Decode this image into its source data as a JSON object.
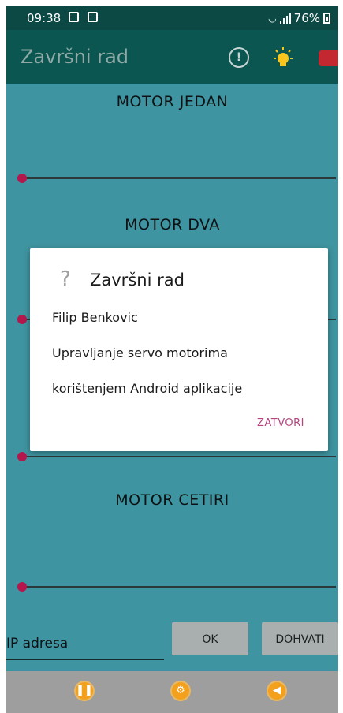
{
  "status_bar": {
    "time": "09:38",
    "battery": "76%"
  },
  "toolbar": {
    "title": "Završni rad",
    "icons": [
      "info-icon",
      "light-bulb-icon",
      "exit-icon"
    ]
  },
  "motors": {
    "motor1": {
      "label": "MOTOR JEDAN",
      "value": 0
    },
    "motor2": {
      "label": "MOTOR DVA",
      "value": 0
    },
    "motor3": {
      "value": 0
    },
    "motor4": {
      "label": "MOTOR CETIRI",
      "value": 0
    }
  },
  "controls": {
    "ip_placeholder": "IP adresa",
    "ok_label": "OK",
    "fetch_label": "DOHVATI"
  },
  "bottom_nav": {
    "icons": [
      "pause-icon",
      "gear-icon",
      "back-icon"
    ]
  },
  "dialog": {
    "title": "Završni rad",
    "lines": [
      "Filip Benkovic",
      "Upravljanje servo motorima",
      "korištenjem Android aplikacije"
    ],
    "close_label": "ZATVORI"
  },
  "colors": {
    "background": "#3e94a0",
    "toolbar": "#0c5652",
    "status_bar": "#0c4844",
    "slider_thumb": "#b5174c",
    "accent_close": "#b4447e",
    "nav_button": "#f3a01c"
  }
}
